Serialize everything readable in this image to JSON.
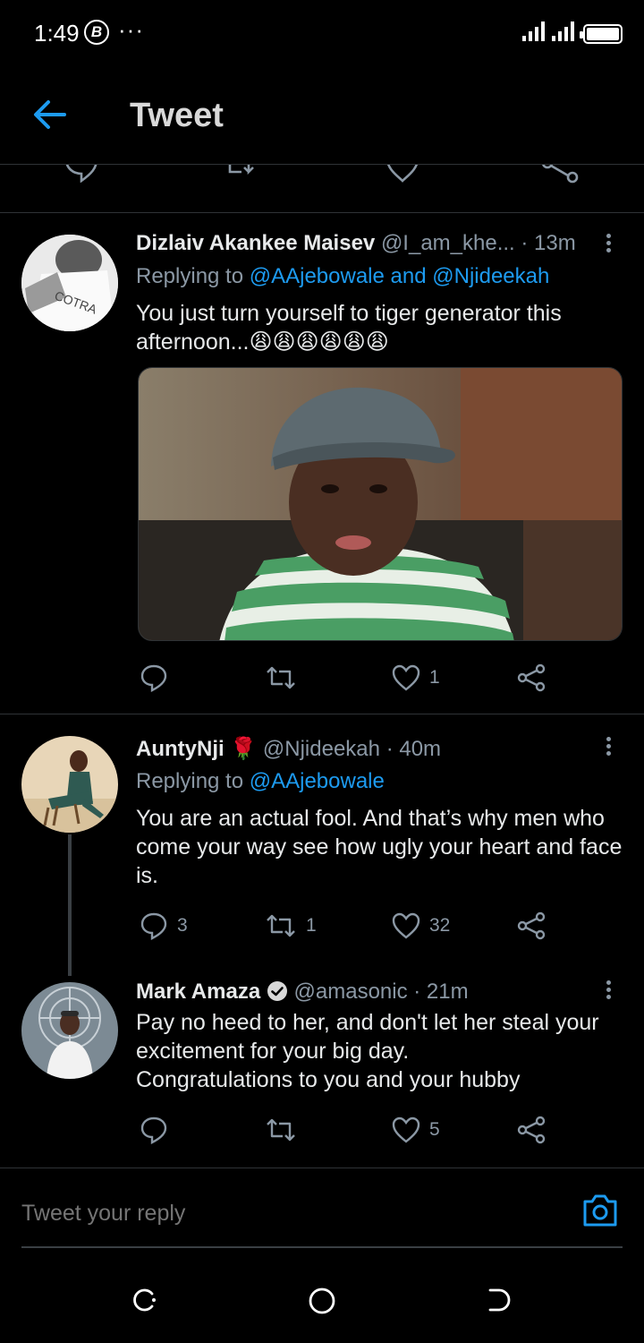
{
  "status_bar": {
    "time": "1:49",
    "app_badge": "B",
    "more": "···"
  },
  "header": {
    "title": "Tweet",
    "back_icon": "arrow-left-icon"
  },
  "tweets": [
    {
      "name": "Dizlaiv Akankee Maisev",
      "handle": "@I_am_khe...",
      "time": "· 13m",
      "replying_label": "Replying to",
      "mentions": "@AAjebowale and @Njideekah",
      "text": "You just turn yourself to tiger generator this afternoon...😩😩😩😩😩😩",
      "has_image": true,
      "counts": {
        "reply": "",
        "retweet": "",
        "like": "1"
      }
    },
    {
      "name": "AuntyNji",
      "emoji": "🌹",
      "handle": "@Njideekah",
      "time": "· 40m",
      "replying_label": "Replying to",
      "mentions": "@AAjebowale",
      "text": "You are an actual fool. And that’s why men who come your way see how ugly your heart and face is.",
      "counts": {
        "reply": "3",
        "retweet": "1",
        "like": "32"
      }
    },
    {
      "name": "Mark Amaza",
      "verified": true,
      "handle": "@amasonic",
      "time": "· 21m",
      "text_lines": [
        "Pay no heed to her, and don't let her steal your",
        "excitement for your big day.",
        "Congratulations to you and your hubby"
      ],
      "counts": {
        "reply": "",
        "retweet": "",
        "like": "5"
      }
    }
  ],
  "reply_bar": {
    "placeholder": "Tweet your reply",
    "camera_icon": "camera-icon"
  },
  "colors": {
    "background": "#000000",
    "accent": "#1d9bf0",
    "muted": "#8b98a5",
    "text": "#e7e9ea"
  }
}
